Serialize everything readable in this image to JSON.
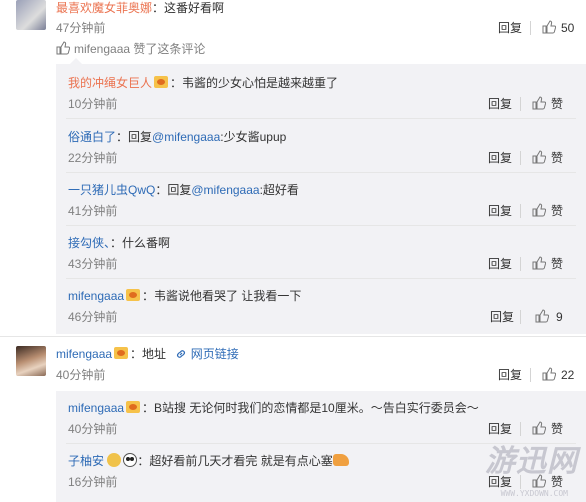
{
  "top_comment": {
    "user": "最喜欢魔女菲奥娜",
    "text": "：这番好看啊",
    "time": "47分钟前",
    "reply_label": "回复",
    "like_count": "50",
    "liked_by": "mifengaaa",
    "liked_text": "赞了这条评论"
  },
  "replies_a": [
    {
      "user": "我的冲绳女巨人",
      "text": "：韦酱的少女心怕是越来越重了",
      "time": "10分钟前",
      "reply_label": "回复",
      "like_label": "赞"
    },
    {
      "user": "俗通白了",
      "text": "：回复",
      "mention": "@mifengaaa",
      "tail": ":少女酱upup",
      "time": "22分钟前",
      "reply_label": "回复",
      "like_label": "赞"
    },
    {
      "user": "一只猪儿虫QwQ",
      "text": "：回复",
      "mention": "@mifengaaa",
      "tail": ":超好看",
      "time": "41分钟前",
      "reply_label": "回复",
      "like_label": "赞"
    },
    {
      "user": "接勾侠、",
      "text": "：什么番啊",
      "time": "43分钟前",
      "reply_label": "回复",
      "like_label": "赞"
    },
    {
      "user": "mifengaaa",
      "text": "：韦酱说他看哭了 让我看一下",
      "time": "46分钟前",
      "reply_label": "回复",
      "like_count": "9"
    }
  ],
  "second_comment": {
    "user": "mifengaaa",
    "text": "：地址",
    "link_label": "网页链接",
    "time": "40分钟前",
    "reply_label": "回复",
    "like_count": "22"
  },
  "replies_b": [
    {
      "user": "mifengaaa",
      "text": "：B站搜 无论何时我们的恋情都是10厘米。～告白实行委员会～",
      "time": "40分钟前",
      "reply_label": "回复",
      "like_label": "赞"
    },
    {
      "user": "子柚安",
      "text": "：超好看前几天才看完 就是有点心塞",
      "time": "16分钟前",
      "reply_label": "回复",
      "like_label": "赞"
    }
  ],
  "watermark": {
    "main": "游迅网",
    "sub": "WWW.YXDOWN.COM"
  },
  "colors": {
    "link": "#eb7350",
    "mention": "#2e6bb6",
    "reply_bg": "#f2f2f5"
  }
}
